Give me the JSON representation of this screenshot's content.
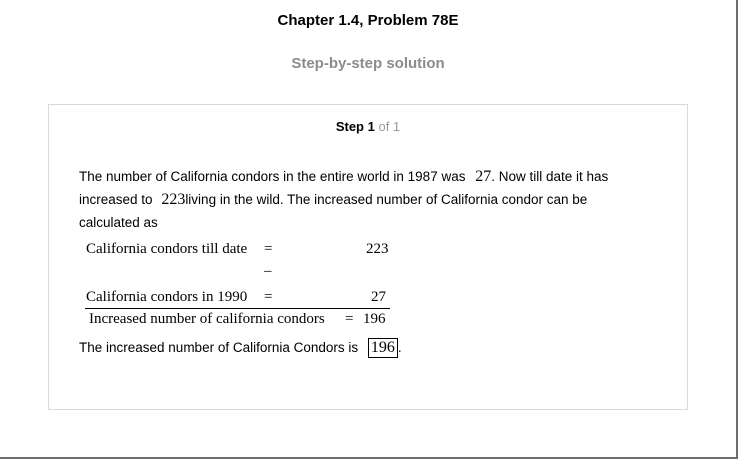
{
  "header": {
    "chapter_title": "Chapter 1.4, Problem 78E",
    "subtitle": "Step-by-step solution"
  },
  "step": {
    "label": "Step 1",
    "of": "of 1"
  },
  "paragraph1": {
    "part1": "The number of California condors in the entire world in 1987 was",
    "value_1987": "27",
    "part2": ". Now till date it has",
    "part3": "increased to",
    "value_now": "223",
    "part4": "living in the wild. The increased number of California condor can be",
    "part5": "calculated as"
  },
  "math": {
    "row1_label": "California condors till date",
    "row1_eq": "=",
    "row1_value": "223",
    "minus": "–",
    "row2_label": "California condors in 1990",
    "row2_eq": "=",
    "row2_value": "27",
    "result_label": "Increased number of california condors",
    "result_eq": "=",
    "result_value": "196"
  },
  "conclusion": {
    "text": "The increased number of California Condors is",
    "answer": "196",
    "end": "."
  }
}
